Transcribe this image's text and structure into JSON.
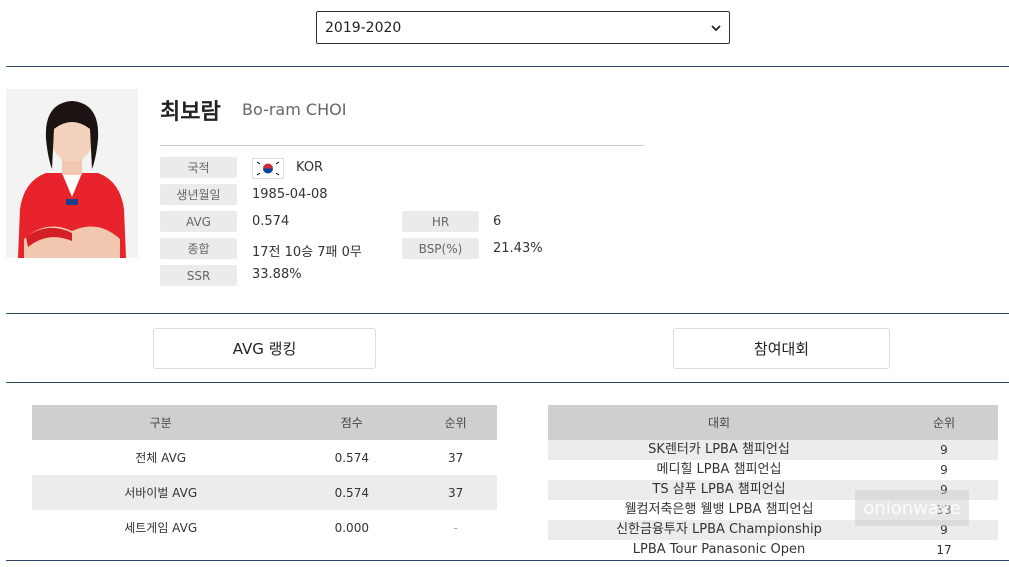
{
  "season_select": {
    "value": "2019-2020"
  },
  "player": {
    "name_ko": "최보람",
    "name_en": "Bo-ram CHOI",
    "info": {
      "nationality_label": "국적",
      "nationality_value": "KOR",
      "birth_label": "생년월일",
      "birth_value": "1985-04-08",
      "avg_label": "AVG",
      "avg_value": "0.574",
      "hr_label": "HR",
      "hr_value": "6",
      "record_label": "종합",
      "record_value": "17전 10승 7패 0무",
      "bsp_label": "BSP(%)",
      "bsp_value": "21.43%",
      "ssr_label": "SSR",
      "ssr_value": "33.88%"
    }
  },
  "tabs": {
    "avg_ranking": "AVG 랭킹",
    "tournaments": "참여대회"
  },
  "avg_table": {
    "headers": [
      "구분",
      "점수",
      "순위"
    ],
    "rows": [
      [
        "전체 AVG",
        "0.574",
        "37"
      ],
      [
        "서바이벌 AVG",
        "0.574",
        "37"
      ],
      [
        "세트게임 AVG",
        "0.000",
        "-"
      ]
    ]
  },
  "tournament_table": {
    "headers": [
      "대회",
      "순위"
    ],
    "rows": [
      [
        "SK렌터카 LPBA 챔피언십",
        "9"
      ],
      [
        "메디힐 LPBA 챔피언십",
        "9"
      ],
      [
        "TS 샴푸 LPBA 챔피언십",
        "9"
      ],
      [
        "웰컴저축은행 웰뱅 LPBA 챔피언십",
        "33"
      ],
      [
        "신한금융투자 LPBA Championship",
        "9"
      ],
      [
        "LPBA Tour Panasonic Open",
        "17"
      ]
    ]
  },
  "watermark": "onionwave",
  "colors": {
    "divider": "#2e4a66",
    "header_bg": "#cfcfcf",
    "stripe_bg": "#ececec",
    "label_bg": "#ebebeb",
    "jersey": "#e8232b"
  }
}
